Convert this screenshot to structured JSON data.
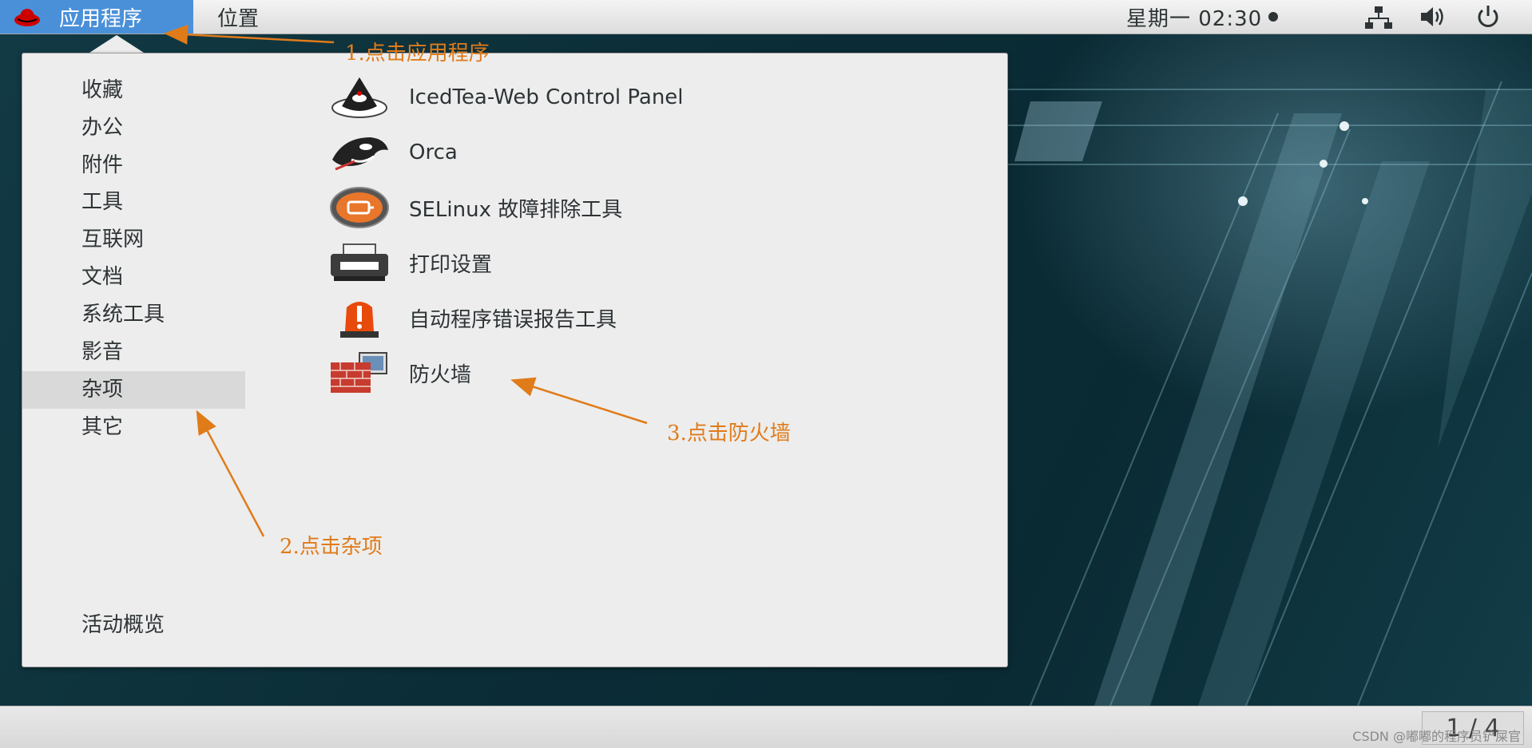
{
  "topbar": {
    "apps_label": "应用程序",
    "places_label": "位置",
    "clock": "星期一 02:30"
  },
  "menu": {
    "categories": [
      {
        "label": "收藏",
        "selected": false
      },
      {
        "label": "办公",
        "selected": false
      },
      {
        "label": "附件",
        "selected": false
      },
      {
        "label": "工具",
        "selected": false
      },
      {
        "label": "互联网",
        "selected": false
      },
      {
        "label": "文档",
        "selected": false
      },
      {
        "label": "系统工具",
        "selected": false
      },
      {
        "label": "影音",
        "selected": false
      },
      {
        "label": "杂项",
        "selected": true
      },
      {
        "label": "其它",
        "selected": false
      }
    ],
    "apps": [
      {
        "label": "IcedTea-Web Control Panel",
        "icon": "java-icon"
      },
      {
        "label": "Orca",
        "icon": "orca-icon"
      },
      {
        "label": "SELinux 故障排除工具",
        "icon": "selinux-icon"
      },
      {
        "label": "打印设置",
        "icon": "printer-icon"
      },
      {
        "label": "自动程序错误报告工具",
        "icon": "alarm-icon"
      },
      {
        "label": "防火墙",
        "icon": "firewall-icon"
      }
    ],
    "activities_label": "活动概览"
  },
  "annotations": {
    "step1": "1.点击应用程序",
    "step2": "2.点击杂项",
    "step3": "3.点击防火墙",
    "color": "#e07b1a"
  },
  "bottombar": {
    "workspace": "1 / 4",
    "watermark": "CSDN @嘟嘟的程序员铲屎官"
  },
  "colors": {
    "accent": "#4a90d9",
    "menu_bg": "#ededed",
    "selected_bg": "#d9d9d9"
  }
}
